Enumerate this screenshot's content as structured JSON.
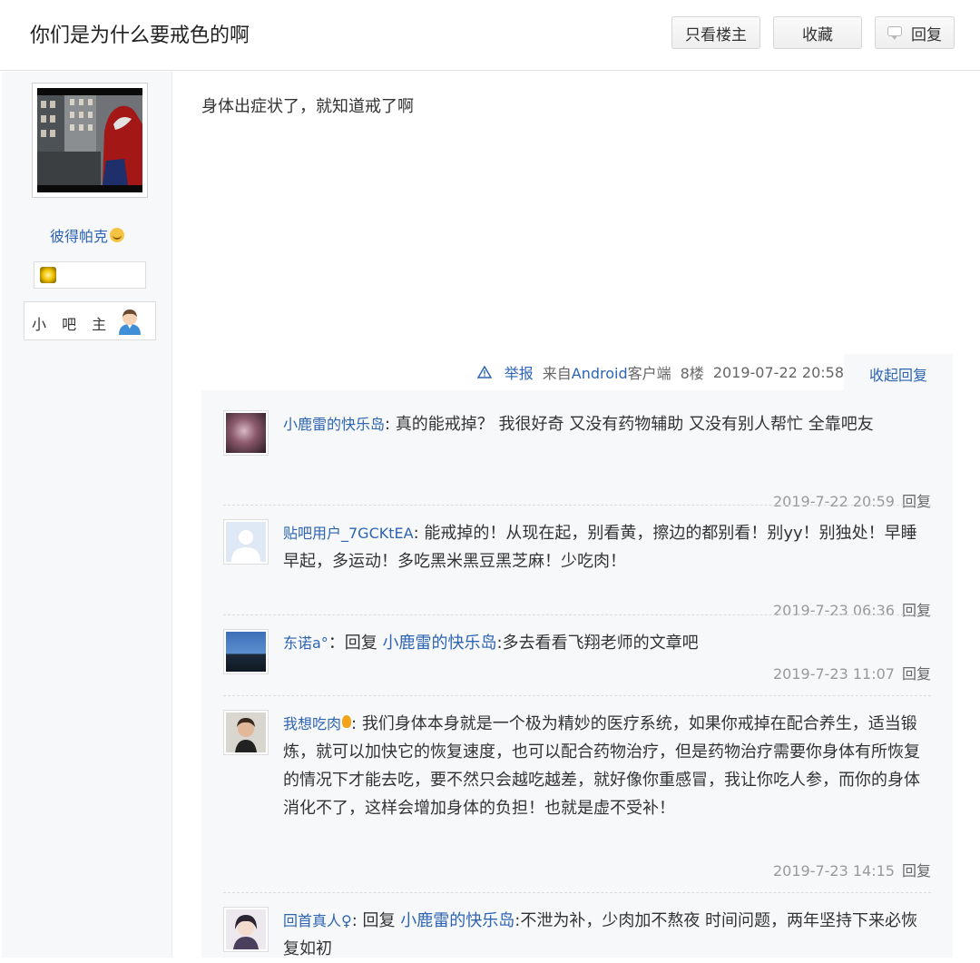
{
  "header": {
    "title": "你们是为什么要戒色的啊",
    "btn_only_op": "只看楼主",
    "btn_favorite": "收藏",
    "btn_reply": "回复"
  },
  "author": {
    "name": "彼得帕克",
    "role": "小 吧 主"
  },
  "post": {
    "content": "身体出症状了，就知道戒了啊",
    "report": "举报",
    "source": "来自Android客户端",
    "floor": "8楼",
    "time": "2019-07-22 20:58",
    "collapse": "收起回复"
  },
  "comments": [
    {
      "user": "小鹿雷的快乐岛",
      "sep": ": ",
      "text": "真的能戒掉？ 我很好奇 又没有药物辅助 又没有别人帮忙 全靠吧友",
      "time": "2019-7-22 20:59",
      "reply": "回复"
    },
    {
      "user": "贴吧用户_7GCKtEA",
      "sep": ": ",
      "text": "能戒掉的！从现在起，别看黄，擦边的都别看！别yy！别独处！早睡早起，多运动！多吃黑米黑豆黑芝麻！少吃肉！",
      "time": "2019-7-23 06:36",
      "reply": "回复"
    },
    {
      "user": "东诺a°",
      "sep": "：回复 ",
      "mention": "小鹿雷的快乐岛",
      "text": ":多去看看飞翔老师的文章吧",
      "time": "2019-7-23 11:07",
      "reply": "回复"
    },
    {
      "user": "我想吃肉",
      "sep": ": ",
      "text": "我们身体本身就是一个极为精妙的医疗系统，如果你戒掉在配合养生，适当锻炼，就可以加快它的恢复速度，也可以配合药物治疗，但是药物治疗需要你身体有所恢复的情况下才能去吃，要不然只会越吃越差，就好像你重感冒，我让你吃人参，而你的身体消化不了，这样会增加身体的负担！也就是虚不受补！",
      "time": "2019-7-23 14:15",
      "reply": "回复"
    },
    {
      "user": "回首真人♀",
      "sep": ": 回复 ",
      "mention": "小鹿雷的快乐岛",
      "text": ":不泄为补，少肉加不熬夜 时间问题，两年坚持下来必恢复如初"
    }
  ],
  "colors": {
    "link": "#2d64b3",
    "muted": "#999999",
    "panel": "#f7f8fa"
  }
}
